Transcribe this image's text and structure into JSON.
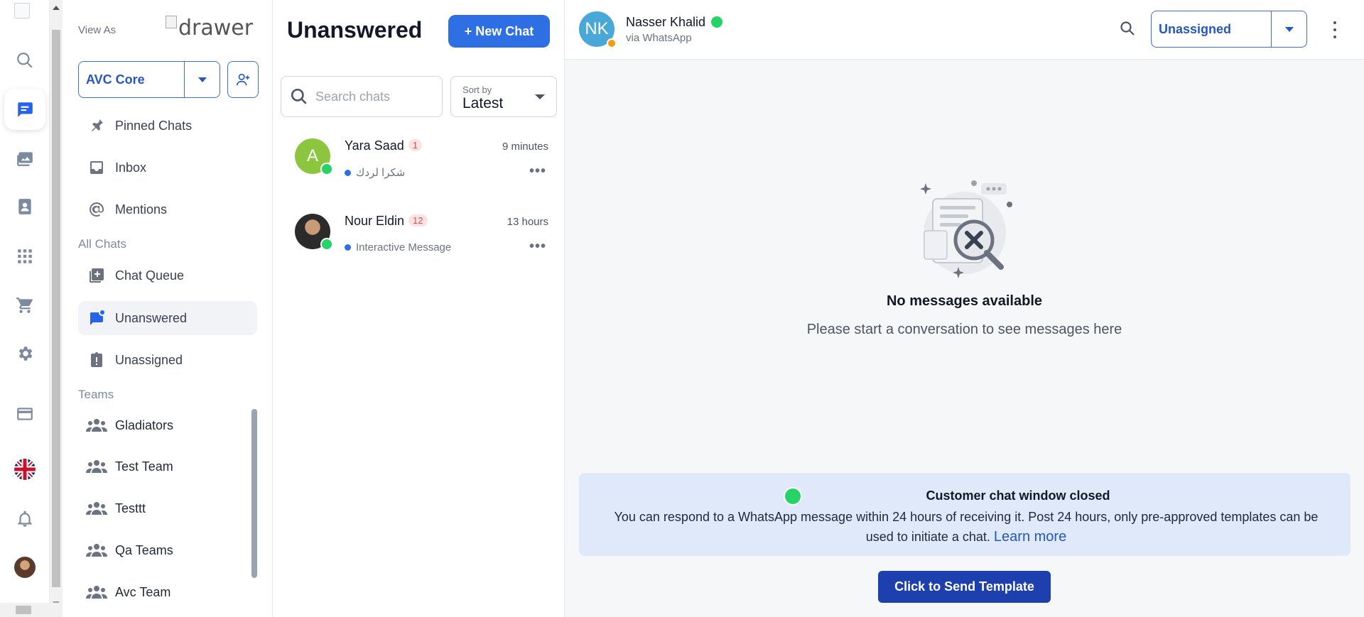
{
  "rail": {
    "icons": [
      "logo-icon",
      "search-icon",
      "chat-icon",
      "media-icon",
      "contacts-icon",
      "apps-icon",
      "cart-icon",
      "settings-icon",
      "billing-icon",
      "uk-flag-icon",
      "bell-icon",
      "user-avatar"
    ],
    "active": "chat-icon"
  },
  "drawer": {
    "view_as_label": "View As",
    "image_alt": "drawer",
    "workspace": "AVC Core",
    "nav": [
      {
        "label": "Pinned Chats",
        "icon": "pin-icon"
      },
      {
        "label": "Inbox",
        "icon": "inbox-icon"
      },
      {
        "label": "Mentions",
        "icon": "at-icon"
      }
    ],
    "all_chats_label": "All Chats",
    "all_chats": [
      {
        "label": "Chat Queue",
        "icon": "queue-icon"
      },
      {
        "label": "Unanswered",
        "icon": "unanswered-icon",
        "active": true
      },
      {
        "label": "Unassigned",
        "icon": "unassigned-icon"
      }
    ],
    "teams_label": "Teams",
    "teams": [
      "Gladiators",
      "Test Team",
      "Testtt",
      "Qa Teams",
      "Avc Team"
    ]
  },
  "list": {
    "title": "Unanswered",
    "new_chat_label": "+ New Chat",
    "search_placeholder": "Search chats",
    "sort_caption": "Sort by",
    "sort_value": "Latest",
    "chats": [
      {
        "name": "Yara Saad",
        "unread": "1",
        "time": "9 minutes",
        "preview": "شكرا لردك",
        "avatar_letter": "A",
        "avatar_color": "#8cc63f"
      },
      {
        "name": "Nour Eldin",
        "unread": "12",
        "time": "13 hours",
        "preview": "Interactive Message",
        "avatar_letter": "",
        "avatar_color": "#3b3b3b"
      }
    ]
  },
  "conversation": {
    "contact_initials": "NK",
    "contact_name": "Nasser Khalid",
    "contact_via": "via WhatsApp",
    "assignee": "Unassigned",
    "empty_title": "No messages available",
    "empty_subtitle": "Please start a conversation to see messages here",
    "notice_title": "Customer chat window closed",
    "notice_text": "You can respond to a WhatsApp message within 24 hours of receiving it. Post 24 hours, only pre-approved templates can be used to initiate a chat.",
    "notice_link": "Learn more",
    "send_template_label": "Click to Send Template"
  },
  "colors": {
    "accent": "#2f6fe4",
    "whatsapp": "#25d366",
    "notice_bg": "#e0e9fa",
    "template_button": "#1e40af"
  }
}
